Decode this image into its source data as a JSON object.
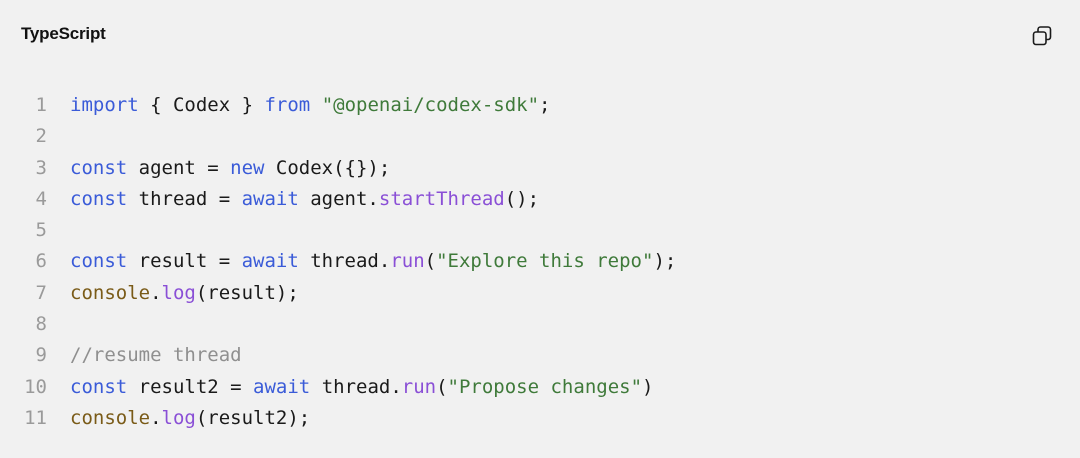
{
  "header": {
    "language": "TypeScript",
    "copy_icon": "copy-icon"
  },
  "colors": {
    "background": "#f1f1f1",
    "keyword": "#3a5bd8",
    "string": "#3f7a3a",
    "function": "#8a4fd6",
    "object": "#7a5b18",
    "comment": "#8f8f8f",
    "plain": "#1a1a1a",
    "line_number": "#9a9a9a"
  },
  "code": {
    "lines": [
      {
        "num": "1",
        "tokens": [
          {
            "t": "kw",
            "v": "import"
          },
          {
            "t": "p",
            "v": " { Codex } "
          },
          {
            "t": "kw",
            "v": "from"
          },
          {
            "t": "p",
            "v": " "
          },
          {
            "t": "str",
            "v": "\"@openai/codex-sdk\""
          },
          {
            "t": "p",
            "v": ";"
          }
        ]
      },
      {
        "num": "2",
        "tokens": []
      },
      {
        "num": "3",
        "tokens": [
          {
            "t": "kw",
            "v": "const"
          },
          {
            "t": "p",
            "v": " agent = "
          },
          {
            "t": "kw",
            "v": "new"
          },
          {
            "t": "p",
            "v": " Codex({});"
          }
        ]
      },
      {
        "num": "4",
        "tokens": [
          {
            "t": "kw",
            "v": "const"
          },
          {
            "t": "p",
            "v": " thread = "
          },
          {
            "t": "kw",
            "v": "await"
          },
          {
            "t": "p",
            "v": " agent."
          },
          {
            "t": "fn",
            "v": "startThread"
          },
          {
            "t": "p",
            "v": "();"
          }
        ]
      },
      {
        "num": "5",
        "tokens": []
      },
      {
        "num": "6",
        "tokens": [
          {
            "t": "kw",
            "v": "const"
          },
          {
            "t": "p",
            "v": " result = "
          },
          {
            "t": "kw",
            "v": "await"
          },
          {
            "t": "p",
            "v": " thread."
          },
          {
            "t": "fn",
            "v": "run"
          },
          {
            "t": "p",
            "v": "("
          },
          {
            "t": "str",
            "v": "\"Explore this repo\""
          },
          {
            "t": "p",
            "v": ");"
          }
        ]
      },
      {
        "num": "7",
        "tokens": [
          {
            "t": "obj",
            "v": "console"
          },
          {
            "t": "p",
            "v": "."
          },
          {
            "t": "fn",
            "v": "log"
          },
          {
            "t": "p",
            "v": "(result);"
          }
        ]
      },
      {
        "num": "8",
        "tokens": []
      },
      {
        "num": "9",
        "tokens": [
          {
            "t": "cm",
            "v": "//resume thread"
          }
        ]
      },
      {
        "num": "10",
        "tokens": [
          {
            "t": "kw",
            "v": "const"
          },
          {
            "t": "p",
            "v": " result2 = "
          },
          {
            "t": "kw",
            "v": "await"
          },
          {
            "t": "p",
            "v": " thread."
          },
          {
            "t": "fn",
            "v": "run"
          },
          {
            "t": "p",
            "v": "("
          },
          {
            "t": "str",
            "v": "\"Propose changes\""
          },
          {
            "t": "p",
            "v": ")"
          }
        ]
      },
      {
        "num": "11",
        "tokens": [
          {
            "t": "obj",
            "v": "console"
          },
          {
            "t": "p",
            "v": "."
          },
          {
            "t": "fn",
            "v": "log"
          },
          {
            "t": "p",
            "v": "(result2);"
          }
        ]
      }
    ]
  }
}
